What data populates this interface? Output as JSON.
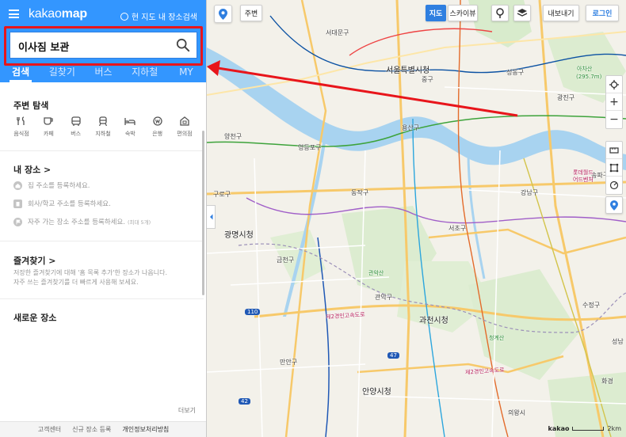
{
  "app": {
    "logo_light": "kakao",
    "logo_bold": "map",
    "current_area_search": "현 지도 내 장소검색"
  },
  "search": {
    "value": "이사짐 보관"
  },
  "tabs": [
    {
      "label": "검색",
      "active": true
    },
    {
      "label": "길찾기"
    },
    {
      "label": "버스"
    },
    {
      "label": "지하철"
    },
    {
      "label": "MY"
    }
  ],
  "nearby": {
    "title": "주변 탐색",
    "categories": [
      {
        "label": "음식점",
        "icon": "restaurant-icon"
      },
      {
        "label": "카페",
        "icon": "cafe-icon"
      },
      {
        "label": "버스",
        "icon": "bus-icon"
      },
      {
        "label": "지하철",
        "icon": "subway-icon"
      },
      {
        "label": "숙박",
        "icon": "hotel-icon"
      },
      {
        "label": "은행",
        "icon": "bank-icon"
      },
      {
        "label": "편의점",
        "icon": "store-icon"
      }
    ]
  },
  "my_places": {
    "title": "내 장소 >",
    "home": "집 주소를 등록하세요.",
    "work": "회사/학교 주소를 등록하세요.",
    "frequent": "자주 가는 장소 주소를 등록하세요.",
    "frequent_note": "(최대 5개)"
  },
  "favorites": {
    "title": "즐겨찾기 >",
    "line1": "저장한 즐겨찾기에 대해 '홈 목록 추가'한 장소가 나옵니다.",
    "line2": "자주 쓰는 즐겨찾기를 더 빠르게 사용해 보세요."
  },
  "new_places": {
    "title": "새로운 장소"
  },
  "more_label": "더보기",
  "footer": [
    "고객센터",
    "신규 장소 등록",
    "개인정보처리방침"
  ],
  "map_controls": {
    "nearby": "주변",
    "map": "지도",
    "skyview": "스카이뷰",
    "export": "내보내기",
    "login": "로그인",
    "zoom_in": "+",
    "zoom_out": "−"
  },
  "map_labels": {
    "seoul_city_hall": "서울특별시청",
    "junggu": "중구",
    "yongsan": "용산구",
    "yeongdeungpo": "영등포구",
    "dongjak": "동작구",
    "seocho": "서초구",
    "gangnam": "강남구",
    "guro": "구로구",
    "gwangmyeong_city": "광명시청",
    "geumcheon": "금천구",
    "gwacheon_city": "과천시청",
    "anyang_city": "안양시청",
    "gwanak": "관악구",
    "manan": "만안구",
    "sujeong": "수정구",
    "gwangjin": "광진구",
    "yangcheon": "양천구",
    "seodaemun": "서대문구",
    "sungdong": "성동구",
    "songpa": "송파구",
    "mt_achasan": "아차산",
    "mt_achasan_height": "(295.7m)",
    "lotte": "롯데월드",
    "adventure": "어드벤처",
    "gwanaksan": "관악산",
    "cheonggyesan": "청계산",
    "uiwang": "의왕시",
    "seongnam": "성남",
    "hwanggyeong": "화경",
    "rt_110": "110",
    "rt_42": "42",
    "rt_47": "47",
    "rd_2nd_ring": "제2경인고속도로",
    "kakao": "kakao",
    "scale": "2km"
  }
}
